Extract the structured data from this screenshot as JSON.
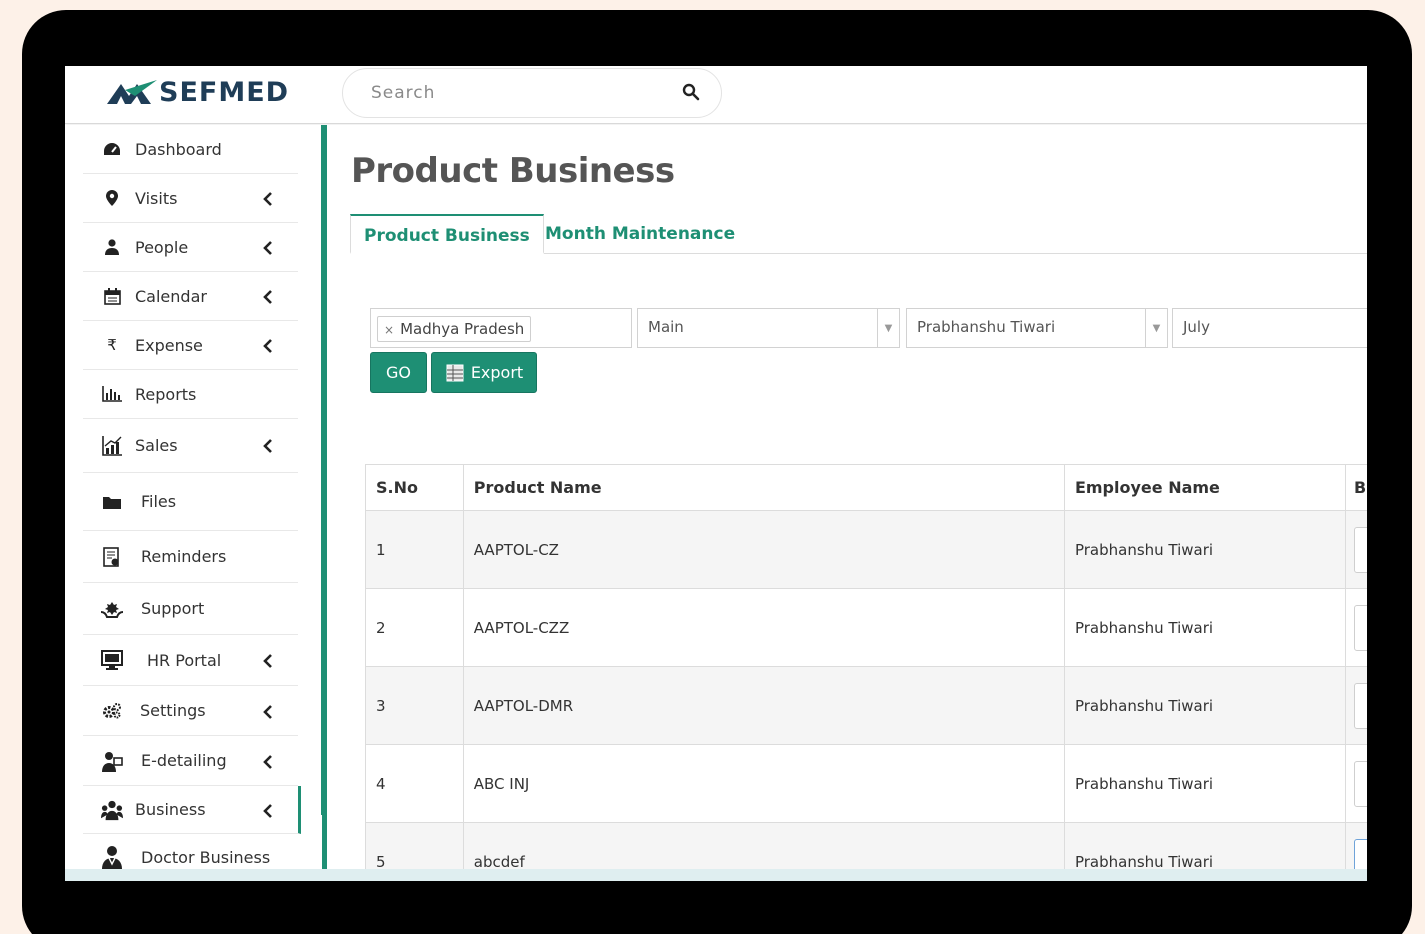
{
  "app": {
    "logo_text": "SEFMED"
  },
  "search": {
    "placeholder": "Search"
  },
  "sidebar": {
    "items": [
      {
        "label": "Dashboard",
        "icon": "dashboard-icon",
        "has_chevron": false
      },
      {
        "label": "Visits",
        "icon": "map-marker-icon",
        "has_chevron": true
      },
      {
        "label": "People",
        "icon": "user-icon",
        "has_chevron": true
      },
      {
        "label": "Calendar",
        "icon": "calendar-icon",
        "has_chevron": true
      },
      {
        "label": "Expense",
        "icon": "rupee-icon",
        "has_chevron": true
      },
      {
        "label": "Reports",
        "icon": "bar-chart-icon",
        "has_chevron": false
      },
      {
        "label": "Sales",
        "icon": "sales-chart-icon",
        "has_chevron": true
      },
      {
        "label": "Files",
        "icon": "folder-icon",
        "has_chevron": false
      },
      {
        "label": "Reminders",
        "icon": "reminder-icon",
        "has_chevron": false
      },
      {
        "label": "Support",
        "icon": "support-icon",
        "has_chevron": false
      },
      {
        "label": "HR Portal",
        "icon": "monitor-icon",
        "has_chevron": true
      },
      {
        "label": "Settings",
        "icon": "gears-icon",
        "has_chevron": true
      },
      {
        "label": "E-detailing",
        "icon": "presenter-icon",
        "has_chevron": true
      },
      {
        "label": "Business",
        "icon": "business-icon",
        "has_chevron": true
      },
      {
        "label": "Doctor Business",
        "icon": "doctor-icon",
        "has_chevron": false
      }
    ]
  },
  "page": {
    "title": "Product Business"
  },
  "tabs": [
    {
      "label": "Product Business",
      "active": true
    },
    {
      "label": "Month Maintenance",
      "active": false
    }
  ],
  "filters": {
    "state_chip": "Madhya Pradesh",
    "state_chip_remove": "×",
    "division": "Main",
    "employee": "Prabhanshu Tiwari",
    "month": "July"
  },
  "buttons": {
    "go": "GO",
    "export": "Export"
  },
  "table": {
    "headers": [
      "S.No",
      "Product Name",
      "Employee Name",
      "B"
    ],
    "rows": [
      {
        "sno": "1",
        "product": "AAPTOL-CZ",
        "employee": "Prabhanshu Tiwari"
      },
      {
        "sno": "2",
        "product": "AAPTOL-CZZ",
        "employee": "Prabhanshu Tiwari"
      },
      {
        "sno": "3",
        "product": "AAPTOL-DMR",
        "employee": "Prabhanshu Tiwari"
      },
      {
        "sno": "4",
        "product": "ABC INJ",
        "employee": "Prabhanshu Tiwari"
      },
      {
        "sno": "5",
        "product": "abcdef",
        "employee": "Prabhanshu Tiwari"
      }
    ]
  },
  "colors": {
    "accent": "#1e8f74",
    "brand": "#1f3d57"
  }
}
